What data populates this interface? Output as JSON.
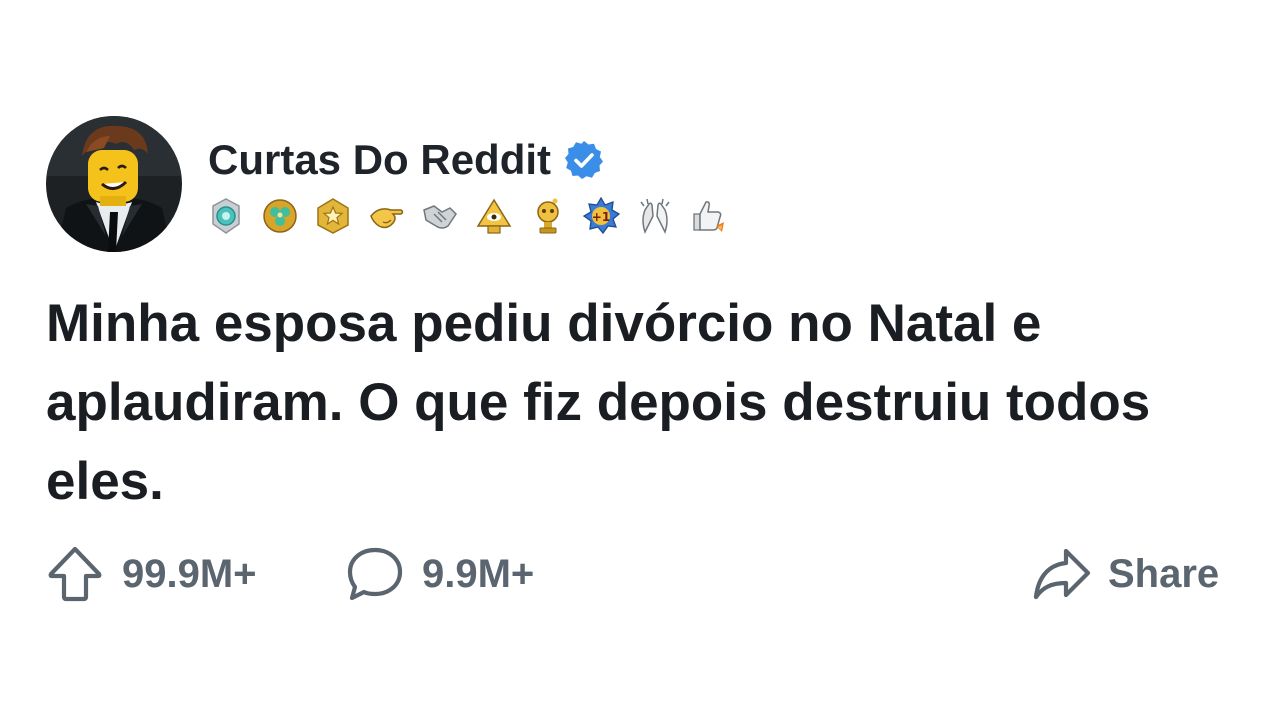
{
  "post": {
    "username": "Curtas Do Reddit",
    "verified": true,
    "title": "Minha esposa pediu divórcio no Natal e aplaudiram. O que fiz depois destruiu todos eles.",
    "awards": [
      "silver-award-icon",
      "wholesome-clover-award-icon",
      "gold-star-award-icon",
      "hand-pointing-award-icon",
      "handshake-award-icon",
      "all-seeing-upvote-award-icon",
      "reddit-gold-trophy-award-icon",
      "plus-one-award-icon",
      "clapping-hands-award-icon",
      "thumbs-up-rocket-award-icon"
    ]
  },
  "actions": {
    "upvotes": "99.9M+",
    "comments": "9.9M+",
    "share_label": "Share"
  },
  "colors": {
    "text_primary": "#1a1d21",
    "text_secondary": "#5b6570",
    "verified_blue": "#3b8ee8",
    "background": "#ffffff"
  }
}
